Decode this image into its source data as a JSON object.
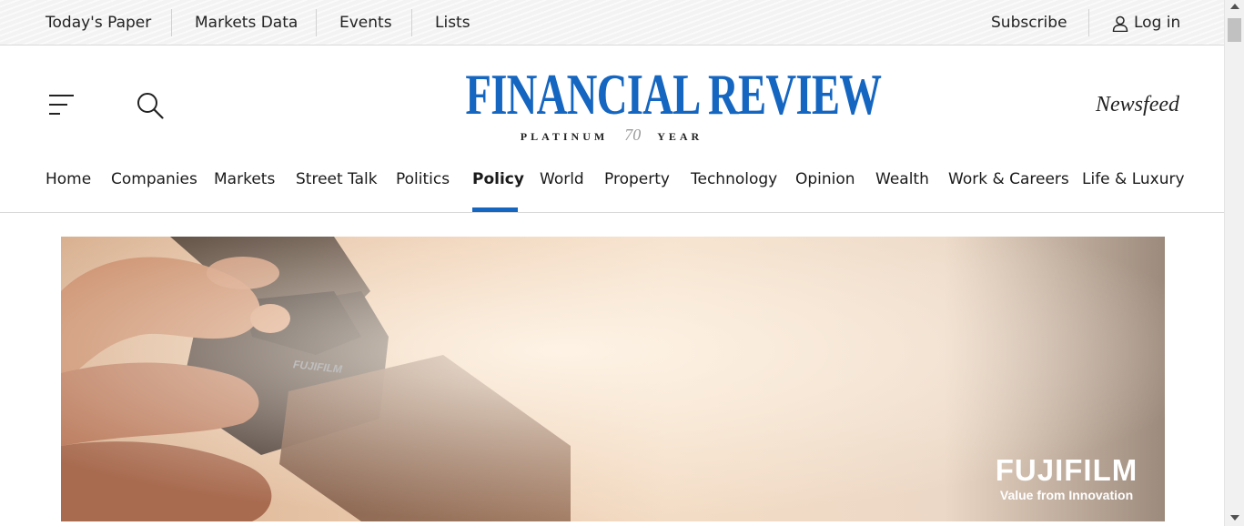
{
  "topbar": {
    "links": [
      "Today's Paper",
      "Markets Data",
      "Events",
      "Lists"
    ],
    "subscribe": "Subscribe",
    "login": "Log in"
  },
  "header": {
    "title": "FINANCIAL REVIEW",
    "subtitle_left": "PLATINUM",
    "subtitle_number": "70",
    "subtitle_right": "YEAR",
    "newsfeed": "Newsfeed",
    "menu_icon": "hamburger-icon",
    "search_icon": "search-icon"
  },
  "nav": {
    "items": [
      "Home",
      "Companies",
      "Markets",
      "Street Talk",
      "Politics",
      "Policy",
      "World",
      "Property",
      "Technology",
      "Opinion",
      "Wealth",
      "Work & Careers",
      "Life & Luxury"
    ],
    "active": "Policy"
  },
  "ad": {
    "brand": "FUJIFILM",
    "tagline": "Value from Innovation",
    "camera_label": "FUJIFILM"
  },
  "colors": {
    "brand_blue": "#1566c0",
    "brand_red": "#e60012"
  }
}
